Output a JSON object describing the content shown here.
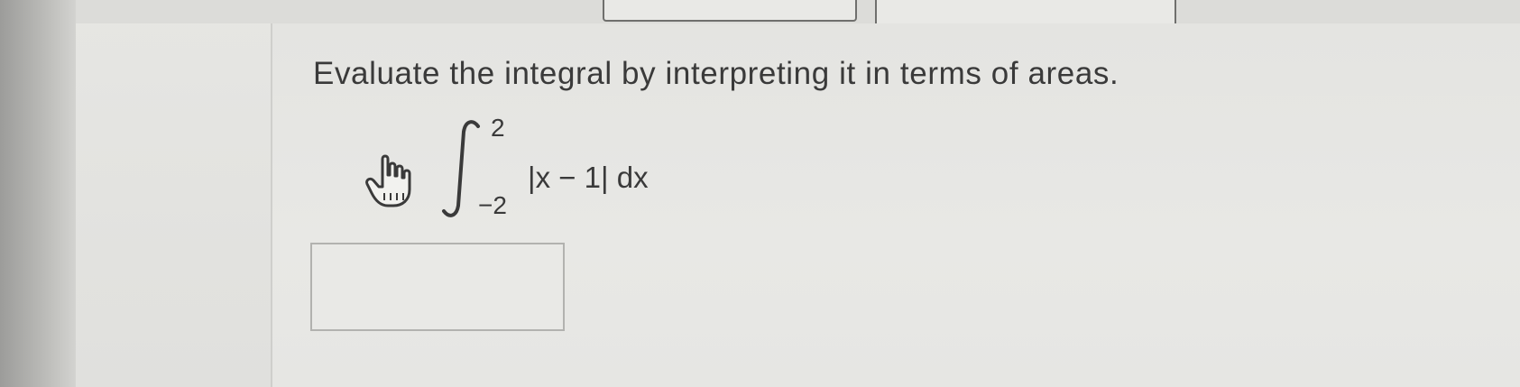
{
  "question": {
    "prompt": "Evaluate the integral by interpreting it in terms of areas.",
    "integral": {
      "upper_limit": "2",
      "lower_limit": "−2",
      "integrand": "|x − 1| dx"
    },
    "hint_icon": "pointing-hand-icon"
  },
  "answer": {
    "value": ""
  }
}
